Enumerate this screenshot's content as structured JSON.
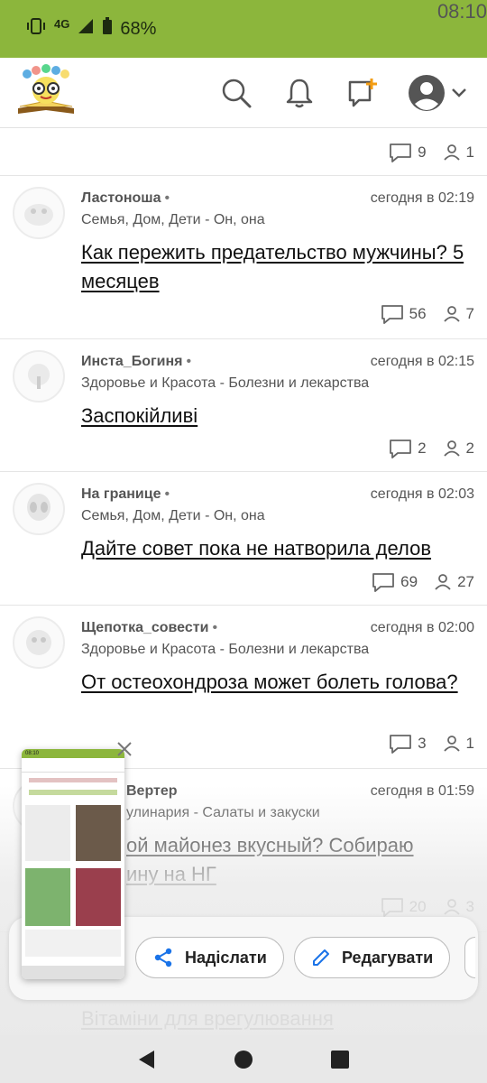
{
  "status_bar": {
    "time": "08:10",
    "network": "4G",
    "battery": "68%"
  },
  "app_bar": {
    "icons": [
      "search-icon",
      "bell-icon",
      "new-message-icon",
      "avatar-icon",
      "chevron-down-icon"
    ]
  },
  "colors": {
    "accent": "#8cb63c",
    "notify": "#f39c12",
    "link": "#111111"
  },
  "posts": [
    {
      "title_cut": "",
      "comments": "9",
      "participants": "1"
    },
    {
      "author": "Ластоноша",
      "time": "сегодня в 02:19",
      "category": "Семья, Дом, Дети - Он, она",
      "title": "Как пережить предательство мужчины? 5 месяцев",
      "comments": "56",
      "participants": "7"
    },
    {
      "author": "Инста_Богиня",
      "time": "сегодня в 02:15",
      "category": "Здоровье и Красота - Болезни и лекарства",
      "title": "Заспокійливі",
      "comments": "2",
      "participants": "2"
    },
    {
      "author": "На границе",
      "time": "сегодня в 02:03",
      "category": "Семья, Дом, Дети - Он, она",
      "title": "Дайте совет пока не натворила делов",
      "comments": "69",
      "participants": "27"
    },
    {
      "author": "Щепотка_совести",
      "time": "сегодня в 02:00",
      "category": "Здоровье и Красота - Болезни и лекарства",
      "title": "От остеохондроза может болеть голова?",
      "comments": "3",
      "participants": "1"
    },
    {
      "author": "Вертер",
      "time": "сегодня в 01:59",
      "category": "улинария - Салаты и закуски",
      "title_line1": "ой майонез вкусный? Собираю",
      "title_line2": "ину на НГ",
      "comments": "20",
      "participants": "3"
    },
    {
      "title": "Вітаміни для врегулювання"
    }
  ],
  "share_sheet": {
    "share_label": "Надіслати",
    "edit_label": "Редагувати"
  },
  "thumbnail": {
    "time": "08:10"
  }
}
